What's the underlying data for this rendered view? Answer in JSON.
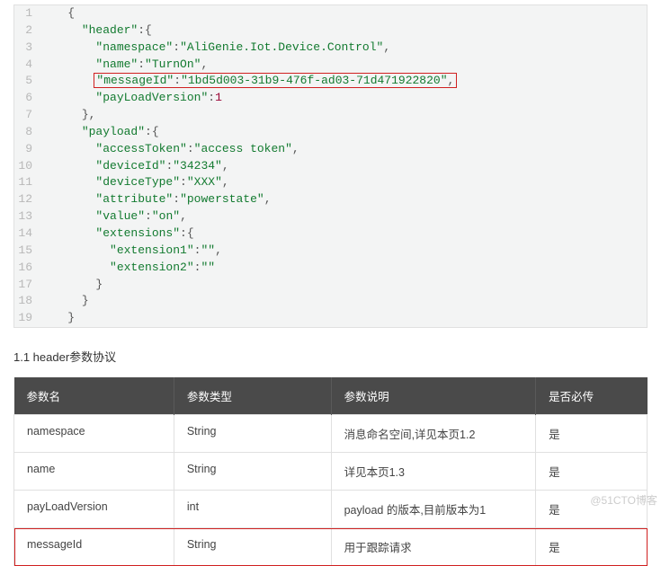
{
  "code": {
    "lines": [
      {
        "n": "1",
        "indent": "    ",
        "tokens": [
          {
            "t": "p",
            "v": "{"
          }
        ]
      },
      {
        "n": "2",
        "indent": "      ",
        "tokens": [
          {
            "t": "k",
            "v": "\"header\""
          },
          {
            "t": "p",
            "v": ":{"
          }
        ]
      },
      {
        "n": "3",
        "indent": "        ",
        "tokens": [
          {
            "t": "k",
            "v": "\"namespace\""
          },
          {
            "t": "p",
            "v": ":"
          },
          {
            "t": "s",
            "v": "\"AliGenie.Iot.Device.Control\""
          },
          {
            "t": "p",
            "v": ","
          }
        ]
      },
      {
        "n": "4",
        "indent": "        ",
        "tokens": [
          {
            "t": "k",
            "v": "\"name\""
          },
          {
            "t": "p",
            "v": ":"
          },
          {
            "t": "s",
            "v": "\"TurnOn\""
          },
          {
            "t": "p",
            "v": ","
          }
        ]
      },
      {
        "n": "5",
        "indent": "        ",
        "hl": true,
        "tokens": [
          {
            "t": "k",
            "v": "\"messageId\""
          },
          {
            "t": "p",
            "v": ":"
          },
          {
            "t": "s",
            "v": "\"1bd5d003-31b9-476f-ad03-71d471922820\""
          },
          {
            "t": "p",
            "v": ","
          }
        ]
      },
      {
        "n": "6",
        "indent": "        ",
        "tokens": [
          {
            "t": "k",
            "v": "\"payLoadVersion\""
          },
          {
            "t": "p",
            "v": ":"
          },
          {
            "t": "n",
            "v": "1"
          }
        ]
      },
      {
        "n": "7",
        "indent": "      ",
        "tokens": [
          {
            "t": "p",
            "v": "},"
          }
        ]
      },
      {
        "n": "8",
        "indent": "      ",
        "tokens": [
          {
            "t": "k",
            "v": "\"payload\""
          },
          {
            "t": "p",
            "v": ":{"
          }
        ]
      },
      {
        "n": "9",
        "indent": "        ",
        "tokens": [
          {
            "t": "k",
            "v": "\"accessToken\""
          },
          {
            "t": "p",
            "v": ":"
          },
          {
            "t": "s",
            "v": "\"access token\""
          },
          {
            "t": "p",
            "v": ","
          }
        ]
      },
      {
        "n": "10",
        "indent": "        ",
        "tokens": [
          {
            "t": "k",
            "v": "\"deviceId\""
          },
          {
            "t": "p",
            "v": ":"
          },
          {
            "t": "s",
            "v": "\"34234\""
          },
          {
            "t": "p",
            "v": ","
          }
        ]
      },
      {
        "n": "11",
        "indent": "        ",
        "tokens": [
          {
            "t": "k",
            "v": "\"deviceType\""
          },
          {
            "t": "p",
            "v": ":"
          },
          {
            "t": "s",
            "v": "\"XXX\""
          },
          {
            "t": "p",
            "v": ","
          }
        ]
      },
      {
        "n": "12",
        "indent": "        ",
        "tokens": [
          {
            "t": "k",
            "v": "\"attribute\""
          },
          {
            "t": "p",
            "v": ":"
          },
          {
            "t": "s",
            "v": "\"powerstate\""
          },
          {
            "t": "p",
            "v": ","
          }
        ]
      },
      {
        "n": "13",
        "indent": "        ",
        "tokens": [
          {
            "t": "k",
            "v": "\"value\""
          },
          {
            "t": "p",
            "v": ":"
          },
          {
            "t": "s",
            "v": "\"on\""
          },
          {
            "t": "p",
            "v": ","
          }
        ]
      },
      {
        "n": "14",
        "indent": "        ",
        "tokens": [
          {
            "t": "k",
            "v": "\"extensions\""
          },
          {
            "t": "p",
            "v": ":{"
          }
        ]
      },
      {
        "n": "15",
        "indent": "          ",
        "tokens": [
          {
            "t": "k",
            "v": "\"extension1\""
          },
          {
            "t": "p",
            "v": ":"
          },
          {
            "t": "s",
            "v": "\"\""
          },
          {
            "t": "p",
            "v": ","
          }
        ]
      },
      {
        "n": "16",
        "indent": "          ",
        "tokens": [
          {
            "t": "k",
            "v": "\"extension2\""
          },
          {
            "t": "p",
            "v": ":"
          },
          {
            "t": "s",
            "v": "\"\""
          }
        ]
      },
      {
        "n": "17",
        "indent": "        ",
        "tokens": [
          {
            "t": "p",
            "v": "}"
          }
        ]
      },
      {
        "n": "18",
        "indent": "      ",
        "tokens": [
          {
            "t": "p",
            "v": "}"
          }
        ]
      },
      {
        "n": "19",
        "indent": "    ",
        "tokens": [
          {
            "t": "p",
            "v": "}"
          }
        ]
      }
    ]
  },
  "section_title": "1.1 header参数协议",
  "table": {
    "headers": [
      "参数名",
      "参数类型",
      "参数说明",
      "是否必传"
    ],
    "rows": [
      {
        "cells": [
          "namespace",
          "String",
          "消息命名空间,详见本页1.2",
          "是"
        ],
        "hl": false
      },
      {
        "cells": [
          "name",
          "String",
          "详见本页1.3",
          "是"
        ],
        "hl": false
      },
      {
        "cells": [
          "payLoadVersion",
          "int",
          "payload 的版本,目前版本为1",
          "是"
        ],
        "hl": false
      },
      {
        "cells": [
          "messageId",
          "String",
          "用于跟踪请求",
          "是"
        ],
        "hl": true
      }
    ]
  },
  "watermark": "@51CTO博客"
}
